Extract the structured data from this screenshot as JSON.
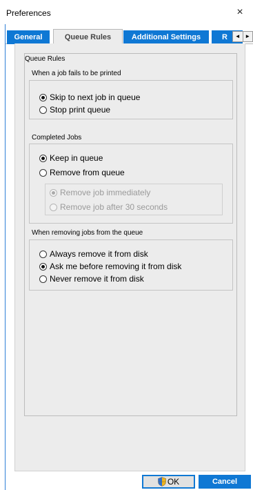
{
  "window": {
    "title": "Preferences",
    "close_glyph": "×"
  },
  "tabs": [
    {
      "label": "General",
      "active": false
    },
    {
      "label": "Queue Rules",
      "active": true
    },
    {
      "label": "Additional Settings",
      "active": false
    },
    {
      "label": "R",
      "active": false
    }
  ],
  "tab_scroll": {
    "left": "◄",
    "right": "►"
  },
  "panel": {
    "title": "Queue Rules",
    "failed_jobs": {
      "label": "When a job fails to be printed",
      "options": [
        {
          "label": "Skip to next job in queue",
          "checked": true
        },
        {
          "label": "Stop print queue",
          "checked": false
        }
      ]
    },
    "completed_jobs": {
      "label": "Completed Jobs",
      "options": [
        {
          "label": "Keep in queue",
          "checked": true
        },
        {
          "label": "Remove from queue",
          "checked": false
        }
      ],
      "sub_options": [
        {
          "label": "Remove job immediately",
          "checked": true,
          "disabled": true
        },
        {
          "label": "Remove job after 30 seconds",
          "checked": false,
          "disabled": true
        }
      ]
    },
    "removing_jobs": {
      "label": "When removing jobs from the queue",
      "options": [
        {
          "label": "Always remove it from disk",
          "checked": false
        },
        {
          "label": "Ask me before removing it from disk",
          "checked": true
        },
        {
          "label": "Never remove it from disk",
          "checked": false
        }
      ]
    }
  },
  "buttons": {
    "ok": "OK",
    "cancel": "Cancel"
  },
  "colors": {
    "accent": "#0f78d4",
    "panel_bg": "#ececec"
  },
  "icons": {
    "ok_button": "shield-icon",
    "close": "close-icon"
  }
}
